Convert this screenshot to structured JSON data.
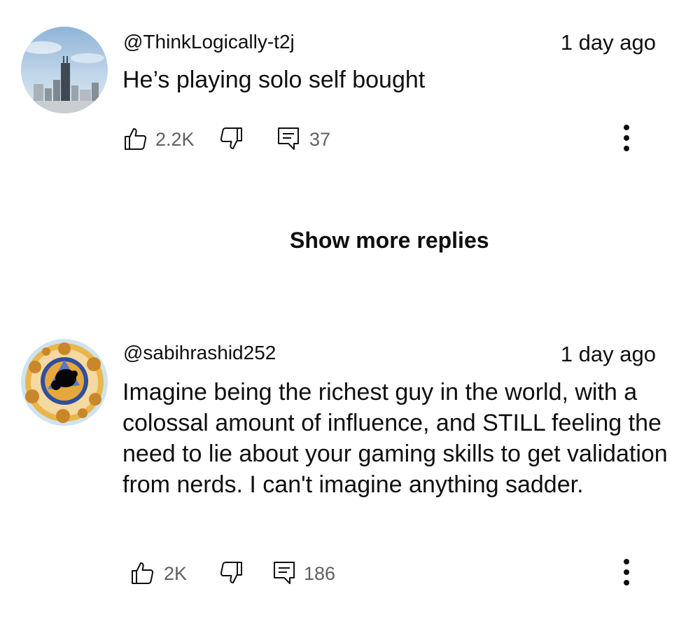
{
  "comments": [
    {
      "handle": "@ThinkLogically-t2j",
      "time": "1 day ago",
      "text": "He’s playing solo self bought",
      "likes": "2.2K",
      "replies": "37",
      "avatar_icon": "city-skyline-avatar"
    },
    {
      "handle": "@sabihrashid252",
      "time": "1 day ago",
      "text": "Imagine being the richest guy in the world, with a colossal amount of influence, and STILL feeling the need to lie about your gaming skills to get validation from nerds. I can't imagine anything sadder.",
      "likes": "2K",
      "replies": "186",
      "avatar_icon": "fractal-avatar"
    }
  ],
  "show_more_label": "Show more replies",
  "colors": {
    "text": "#0f0f0f",
    "secondary": "#606060"
  }
}
